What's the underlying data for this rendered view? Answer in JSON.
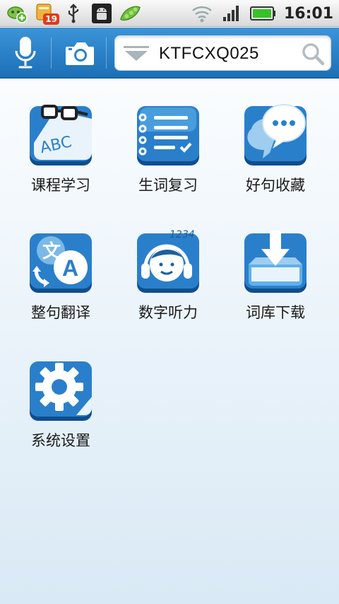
{
  "status_bar": {
    "time": "16:01",
    "notification_count": "19",
    "icons": [
      "game-controller-add-icon",
      "notification-app-icon",
      "usb-icon",
      "android-debug-icon",
      "peas-app-icon",
      "wifi-icon",
      "signal-icon",
      "battery-icon"
    ]
  },
  "toolbar": {
    "voice_icon": "microphone-icon",
    "camera_icon": "camera-icon",
    "search": {
      "value": "KTFCXQ025",
      "dropdown_icon": "chevron-down-icon",
      "search_icon": "search-icon"
    }
  },
  "menu": {
    "items": [
      {
        "label": "课程学习",
        "icon": "abc-glasses-icon"
      },
      {
        "label": "生词复习",
        "icon": "notebook-list-icon"
      },
      {
        "label": "好句收藏",
        "icon": "speech-bubble-icon"
      },
      {
        "label": "整句翻译",
        "icon": "translate-icon"
      },
      {
        "label": "数字听力",
        "icon": "headphones-numbers-icon"
      },
      {
        "label": "词库下载",
        "icon": "download-box-icon"
      },
      {
        "label": "系统设置",
        "icon": "gear-icon"
      }
    ]
  },
  "colors": {
    "toolbar": "#2a82c9",
    "icon_blue": "#1f6fb8",
    "icon_highlight": "#5fb0ea"
  }
}
